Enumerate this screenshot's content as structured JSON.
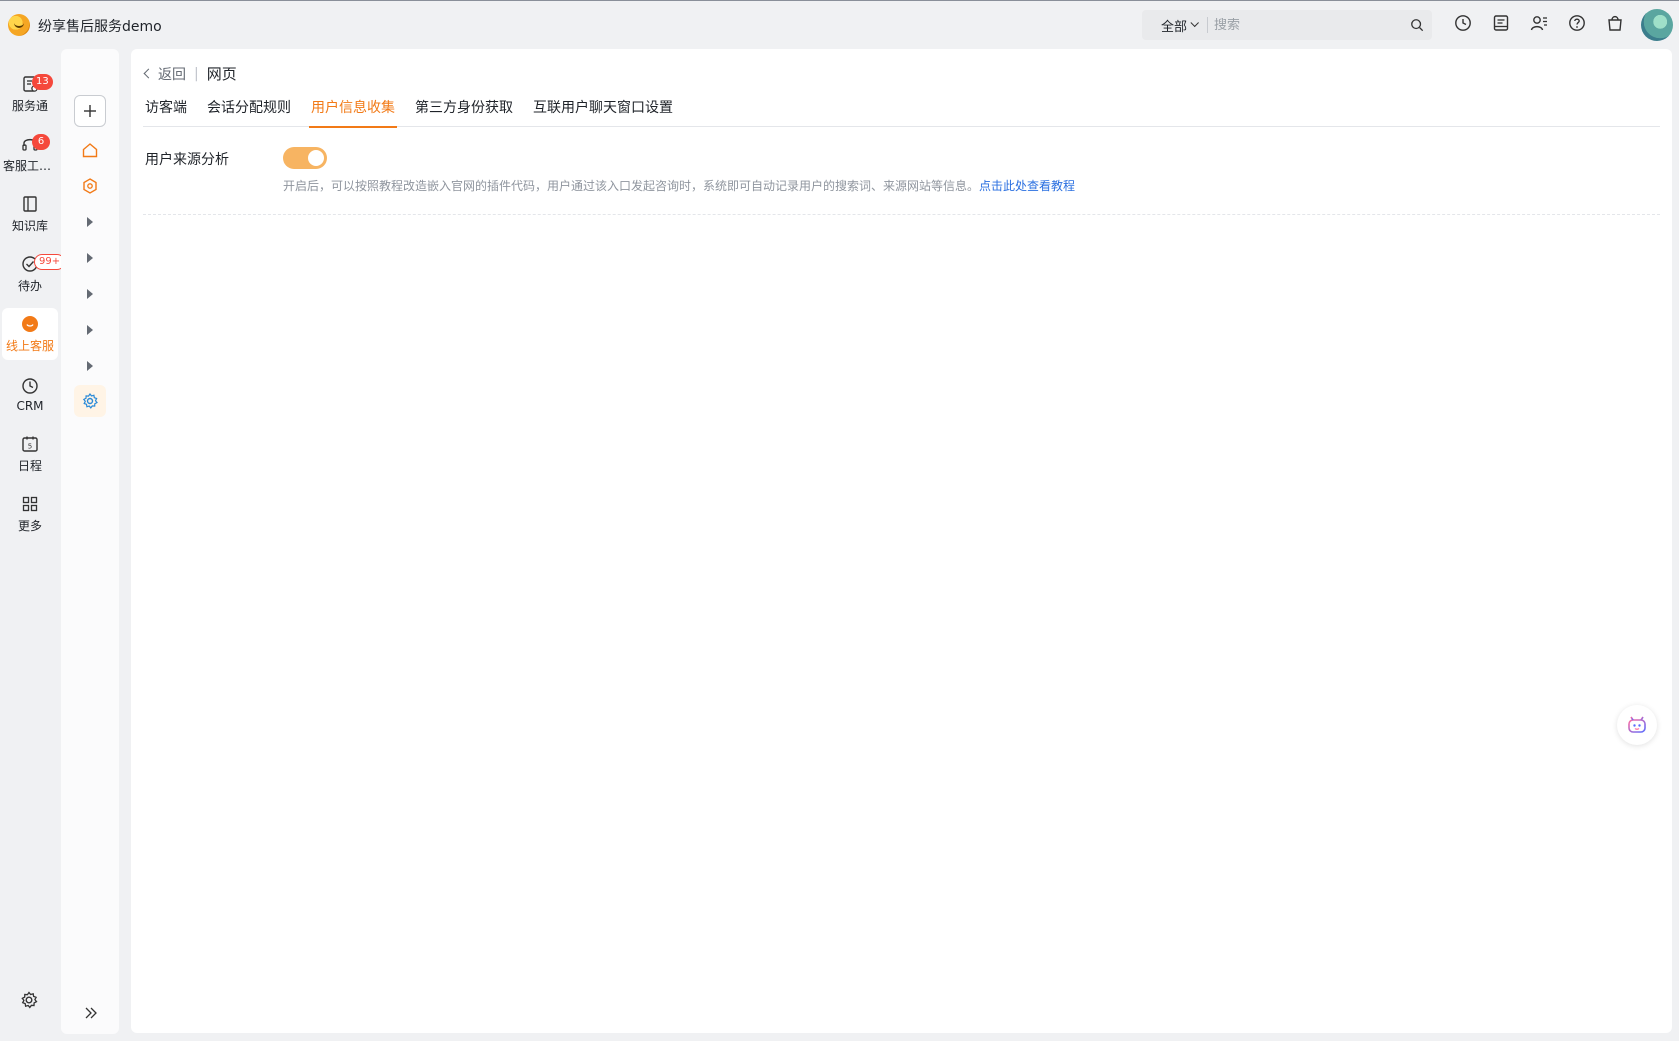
{
  "app": {
    "name": "纷享售后服务demo",
    "logo_icon": "cartoon-mascot-logo"
  },
  "search": {
    "scope": "全部",
    "placeholder": "搜索"
  },
  "top_icons": [
    "clock-icon",
    "message-icon",
    "contacts-icon",
    "help-icon",
    "bag-icon"
  ],
  "rail": {
    "items": [
      {
        "label": "服务通",
        "badge": "13",
        "icon": "service-icon"
      },
      {
        "label": "客服工作台",
        "badge": "6",
        "icon": "headset-icon"
      },
      {
        "label": "知识库",
        "badge": "",
        "icon": "book-icon"
      },
      {
        "label": "待办",
        "badge": "99+",
        "icon": "check-circle-icon"
      },
      {
        "label": "线上客服",
        "badge": "",
        "icon": "online-service-icon",
        "active": true
      },
      {
        "label": "CRM",
        "badge": "",
        "icon": "crm-icon"
      },
      {
        "label": "日程",
        "badge": "",
        "icon": "calendar-icon",
        "calendar_day": "5"
      },
      {
        "label": "更多",
        "badge": "",
        "icon": "grid-icon"
      }
    ]
  },
  "breadcrumb": {
    "back": "返回",
    "title": "网页"
  },
  "tabs": [
    {
      "label": "访客端"
    },
    {
      "label": "会话分配规则"
    },
    {
      "label": "用户信息收集",
      "active": true
    },
    {
      "label": "第三方身份获取"
    },
    {
      "label": "互联用户聊天窗口设置"
    }
  ],
  "setting": {
    "label": "用户来源分析",
    "enabled": true,
    "description": "开启后，可以按照教程改造嵌入官网的插件代码，用户通过该入口发起咨询时，系统即可自动记录用户的搜索词、来源网站等信息。",
    "link": "点击此处查看教程"
  },
  "colors": {
    "accent": "#f27a17",
    "link": "#2a6fe0",
    "badge": "#f5483b",
    "toggle_on": "#f7b462"
  }
}
